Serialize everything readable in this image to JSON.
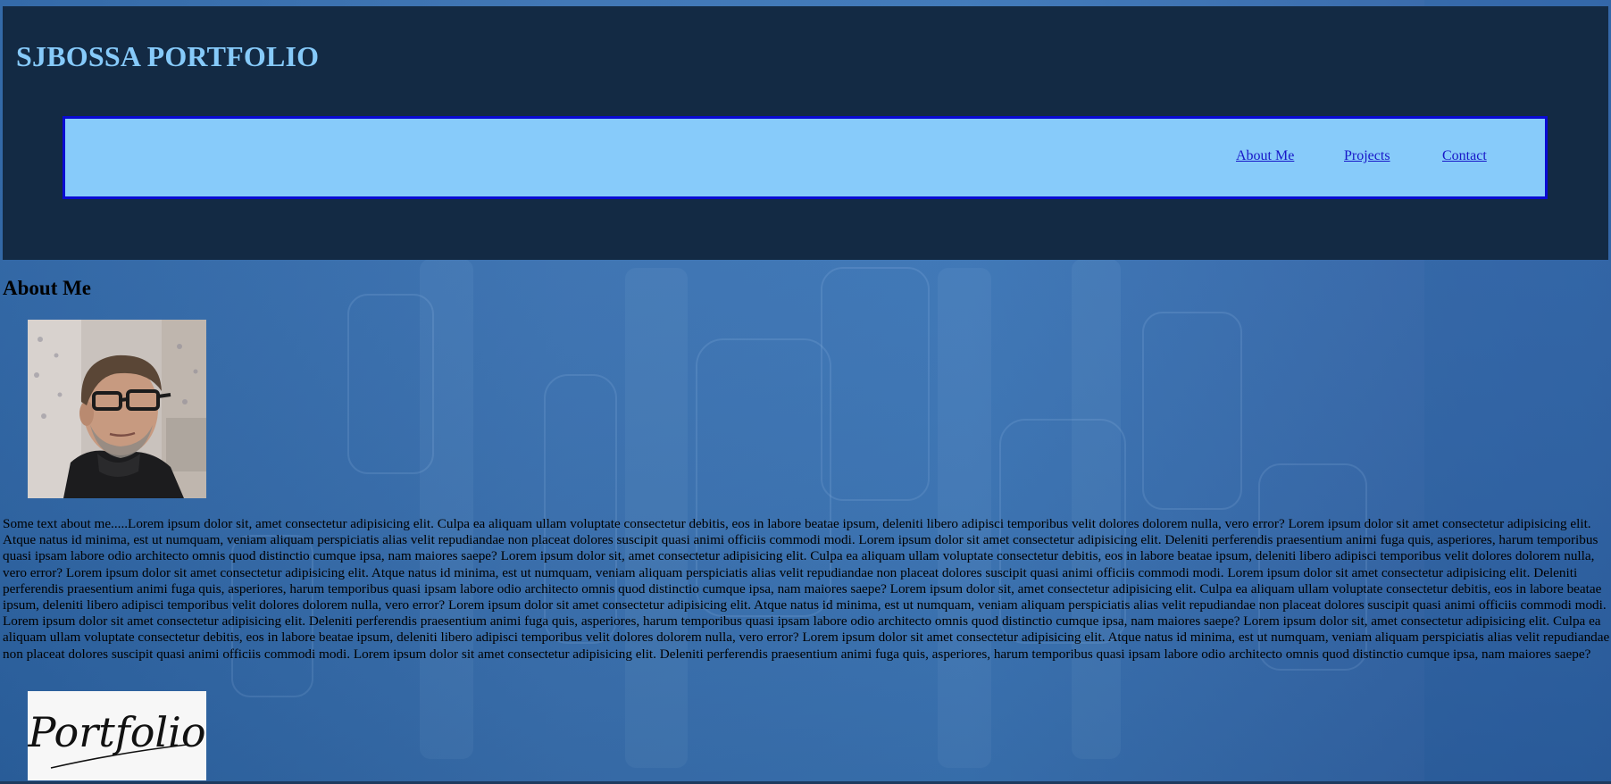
{
  "header": {
    "title": "SJBOSSA PORTFOLIO",
    "nav": {
      "about": "About Me",
      "projects": "Projects",
      "contact": "Contact"
    }
  },
  "about": {
    "heading": "About Me",
    "text": "Some text about me.....Lorem ipsum dolor sit, amet consectetur adipisicing elit. Culpa ea aliquam ullam voluptate consectetur debitis, eos in labore beatae ipsum, deleniti libero adipisci temporibus velit dolores dolorem nulla, vero error? Lorem ipsum dolor sit amet consectetur adipisicing elit. Atque natus id minima, est ut numquam, veniam aliquam perspiciatis alias velit repudiandae non placeat dolores suscipit quasi animi officiis commodi modi. Lorem ipsum dolor sit amet consectetur adipisicing elit. Deleniti perferendis praesentium animi fuga quis, asperiores, harum temporibus quasi ipsam labore odio architecto omnis quod distinctio cumque ipsa, nam maiores saepe? Lorem ipsum dolor sit, amet consectetur adipisicing elit. Culpa ea aliquam ullam voluptate consectetur debitis, eos in labore beatae ipsum, deleniti libero adipisci temporibus velit dolores dolorem nulla, vero error? Lorem ipsum dolor sit amet consectetur adipisicing elit. Atque natus id minima, est ut numquam, veniam aliquam perspiciatis alias velit repudiandae non placeat dolores suscipit quasi animi officiis commodi modi. Lorem ipsum dolor sit amet consectetur adipisicing elit. Deleniti perferendis praesentium animi fuga quis, asperiores, harum temporibus quasi ipsam labore odio architecto omnis quod distinctio cumque ipsa, nam maiores saepe? Lorem ipsum dolor sit, amet consectetur adipisicing elit. Culpa ea aliquam ullam voluptate consectetur debitis, eos in labore beatae ipsum, deleniti libero adipisci temporibus velit dolores dolorem nulla, vero error? Lorem ipsum dolor sit amet consectetur adipisicing elit. Atque natus id minima, est ut numquam, veniam aliquam perspiciatis alias velit repudiandae non placeat dolores suscipit quasi animi officiis commodi modi. Lorem ipsum dolor sit amet consectetur adipisicing elit. Deleniti perferendis praesentium animi fuga quis, asperiores, harum temporibus quasi ipsam labore odio architecto omnis quod distinctio cumque ipsa, nam maiores saepe? Lorem ipsum dolor sit, amet consectetur adipisicing elit. Culpa ea aliquam ullam voluptate consectetur debitis, eos in labore beatae ipsum, deleniti libero adipisci temporibus velit dolores dolorem nulla, vero error? Lorem ipsum dolor sit amet consectetur adipisicing elit. Atque natus id minima, est ut numquam, veniam aliquam perspiciatis alias velit repudiandae non placeat dolores suscipit quasi animi officiis commodi modi. Lorem ipsum dolor sit amet consectetur adipisicing elit. Deleniti perferendis praesentium animi fuga quis, asperiores, harum temporibus quasi ipsam labore odio architecto omnis quod distinctio cumque ipsa, nam maiores saepe?",
    "logo_text": "Portfolio"
  },
  "colors": {
    "background": "#2f67a8",
    "header_bg": "#132a44",
    "title": "#86cafa",
    "navbar_bg": "#87cbfa",
    "navbar_border": "#0a0ad2",
    "link": "#1818c8"
  },
  "icons": {
    "photo": "profile-photo",
    "logo": "portfolio-logo"
  }
}
